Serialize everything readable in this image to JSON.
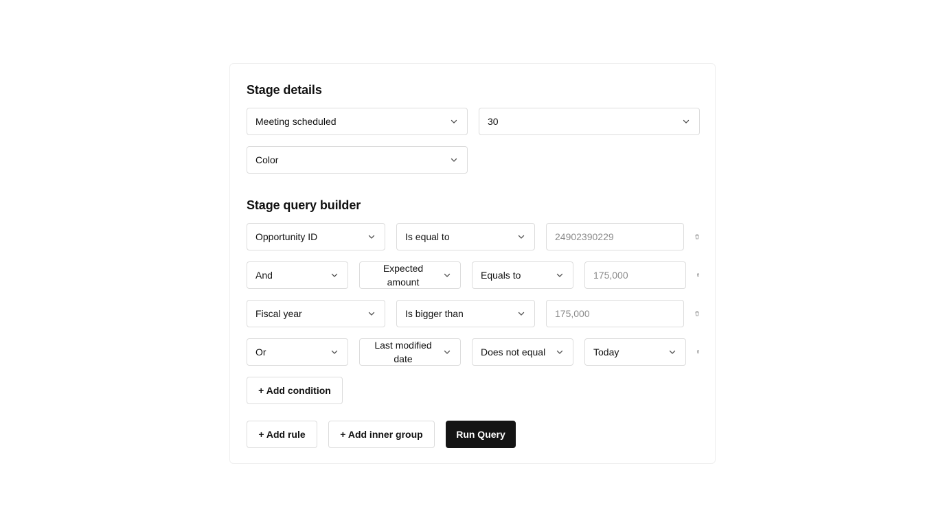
{
  "stage_details": {
    "heading": "Stage details",
    "stage_select": "Meeting scheduled",
    "probability_select": "30",
    "color_select": "Color"
  },
  "query_builder": {
    "heading": "Stage query builder",
    "rows": [
      {
        "field": "Opportunity ID",
        "operator": "Is equal to",
        "value_placeholder": "24902390229"
      },
      {
        "connector": "And",
        "field": "Expected amount",
        "operator": "Equals to",
        "value_placeholder": "175,000"
      },
      {
        "field": "Fiscal year",
        "operator": "Is bigger than",
        "value_placeholder": "175,000"
      },
      {
        "connector": "Or",
        "field": "Last modified date",
        "operator": "Does not equal",
        "value_select": "Today"
      }
    ],
    "add_condition_label": "+ Add condition"
  },
  "actions": {
    "add_rule_label": "+ Add rule",
    "add_inner_group_label": "+ Add inner group",
    "run_query_label": "Run Query"
  },
  "icons": {
    "select_arrow": "chevron-down-icon",
    "remove_row": "trash-icon"
  },
  "colors": {
    "primary_button": "#141414",
    "border": "#dcdcdc",
    "placeholder": "#8a8a8a"
  }
}
